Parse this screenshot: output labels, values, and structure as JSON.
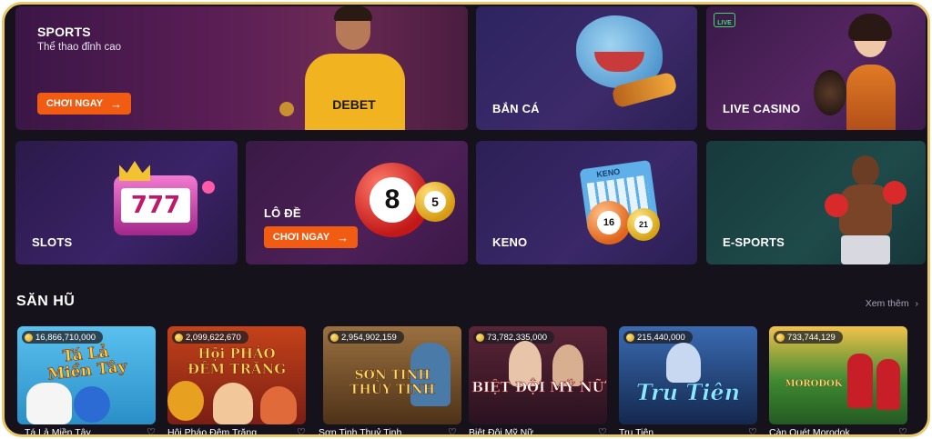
{
  "categories": {
    "sports": {
      "title": "SPORTS",
      "subtitle": "Thể thao đỉnh cao",
      "cta": "CHƠI NGAY",
      "jersey": "DEBET"
    },
    "ban_ca": {
      "title": "BẮN CÁ"
    },
    "live_casino": {
      "title": "LIVE CASINO",
      "live_badge": "LIVE"
    },
    "slots": {
      "title": "SLOTS",
      "reel": "777"
    },
    "lo_de": {
      "title": "LÔ ĐỀ",
      "cta": "CHƠI NGAY",
      "ball1": "8",
      "ball2": "5"
    },
    "keno": {
      "title": "KENO",
      "card_label": "KENO",
      "ball1": "16",
      "ball2": "21"
    },
    "esports": {
      "title": "E-SPORTS"
    }
  },
  "section": {
    "title": "SĂN HŨ",
    "see_more": "Xem thêm"
  },
  "games": [
    {
      "jackpot": "16,866,710,000",
      "name": "Tá Lả Miền Tây",
      "art_text": "Tá Lả\nMiền Tây",
      "bg": "#2a8fc7"
    },
    {
      "jackpot": "2,099,622,670",
      "name": "Hội Pháo Đêm Trăng",
      "art_text": "Hội PHÁO\nĐÊM TRĂNG",
      "bg": "#8a2a1a"
    },
    {
      "jackpot": "2,954,902,159",
      "name": "Sơn Tinh Thuỷ Tinh",
      "art_text": "SƠN TINH\nTHỦY TINH",
      "bg": "#6b4a22"
    },
    {
      "jackpot": "73,782,335,000",
      "name": "Biệt Đội Mỹ Nữ",
      "art_text": "BIỆT ĐỘI MỸ NỮ",
      "bg": "#3a1d2c"
    },
    {
      "jackpot": "215,440,000",
      "name": "Tru Tiên",
      "art_text": "Tru Tiên",
      "bg": "#1c3a6e"
    },
    {
      "jackpot": "733,744,129",
      "name": "Càn Quét Morodok",
      "art_text": "MORODOK",
      "bg": "#2f6a2c"
    }
  ],
  "colors": {
    "accent": "#f25c12",
    "frame": "#e8c86a",
    "background": "#16121c"
  }
}
